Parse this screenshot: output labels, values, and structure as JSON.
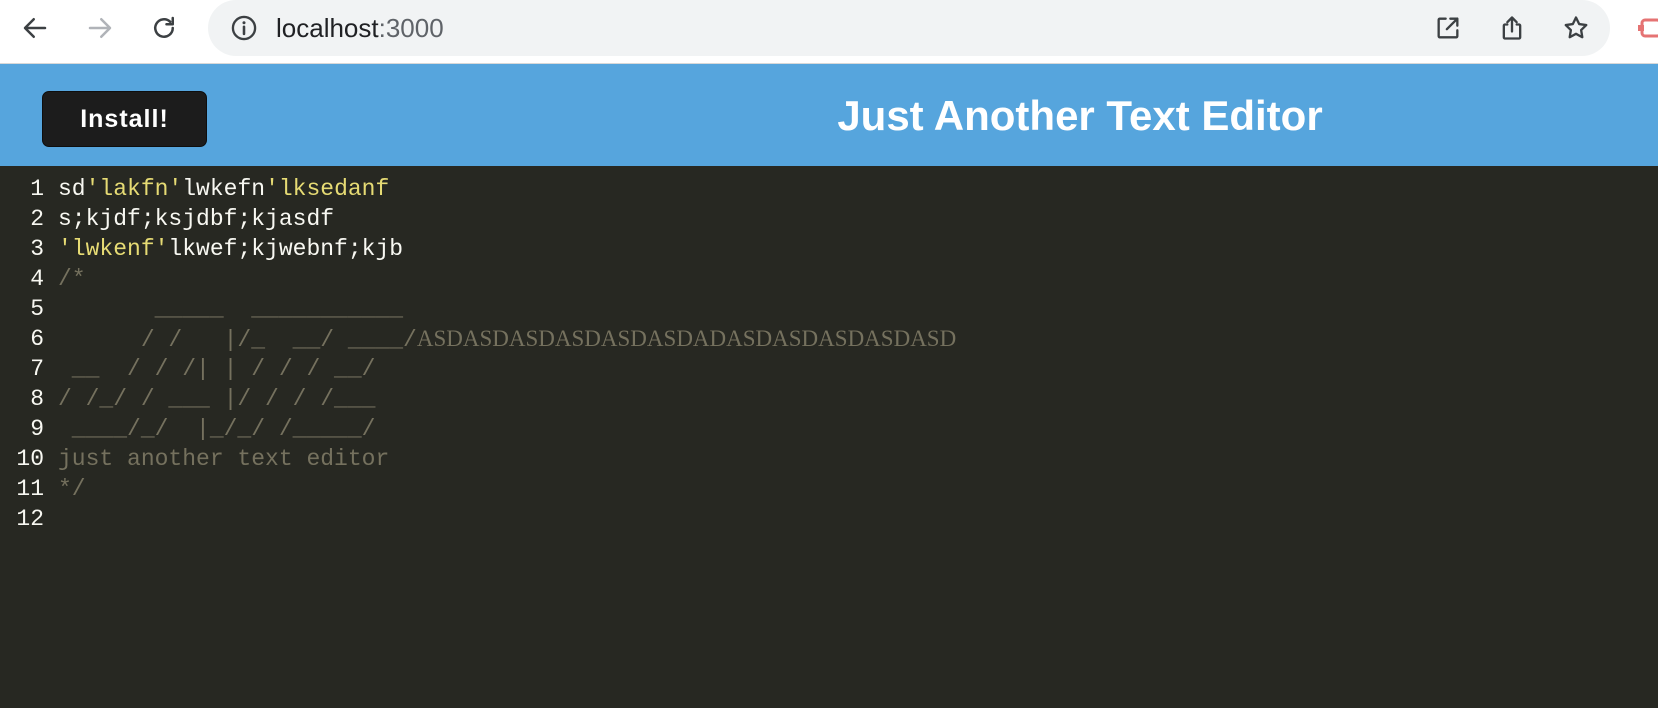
{
  "browser": {
    "url_host": "localhost",
    "url_port": ":3000",
    "icons": {
      "back": "arrow-left-icon",
      "forward": "arrow-right-icon",
      "reload": "reload-icon",
      "site_info": "info-icon",
      "open_external": "open-external-icon",
      "share": "share-icon",
      "bookmark": "star-icon",
      "extension": "extension-icon"
    }
  },
  "header": {
    "install_label": "Install!",
    "title": "Just Another Text Editor",
    "background_color": "#56a5dd"
  },
  "editor": {
    "theme_background": "#272822",
    "lines": [
      {
        "number": "1",
        "segments": [
          {
            "t": "sd"
          },
          {
            "t": "'lakfn'",
            "kind": "str"
          },
          {
            "t": "lwkefn"
          },
          {
            "t": "'lksedanf",
            "kind": "str"
          }
        ]
      },
      {
        "number": "2",
        "segments": [
          {
            "t": "s;kjdf;ksjdbf;kjasdf"
          }
        ]
      },
      {
        "number": "3",
        "segments": [
          {
            "t": "'lwkenf'",
            "kind": "str"
          },
          {
            "t": "lkwef;kjwebnf;kjb"
          }
        ]
      },
      {
        "number": "4",
        "segments": [
          {
            "t": "/*",
            "kind": "com"
          }
        ]
      },
      {
        "number": "5",
        "segments": [
          {
            "t": "       _____  ___________",
            "kind": "com"
          }
        ]
      },
      {
        "number": "6",
        "segments": [
          {
            "t": "      / /   |/_  __/ ____/",
            "kind": "com"
          },
          {
            "t": "ASDASDASDASDASDASDADASDASDASDASDASD",
            "kind": "com-serif"
          }
        ]
      },
      {
        "number": "7",
        "segments": [
          {
            "t": " __  / / /| | / / / __/",
            "kind": "com"
          }
        ]
      },
      {
        "number": "8",
        "segments": [
          {
            "t": "/ /_/ / ___ |/ / / /___",
            "kind": "com"
          }
        ]
      },
      {
        "number": "9",
        "segments": [
          {
            "t": " ____/_/  |_/_/ /_____/",
            "kind": "com"
          }
        ]
      },
      {
        "number": "10",
        "segments": [
          {
            "t": "just another text editor",
            "kind": "com"
          }
        ]
      },
      {
        "number": "11",
        "segments": [
          {
            "t": "*/",
            "kind": "com"
          }
        ]
      },
      {
        "number": "12",
        "segments": [
          {
            "t": ""
          }
        ]
      }
    ]
  }
}
